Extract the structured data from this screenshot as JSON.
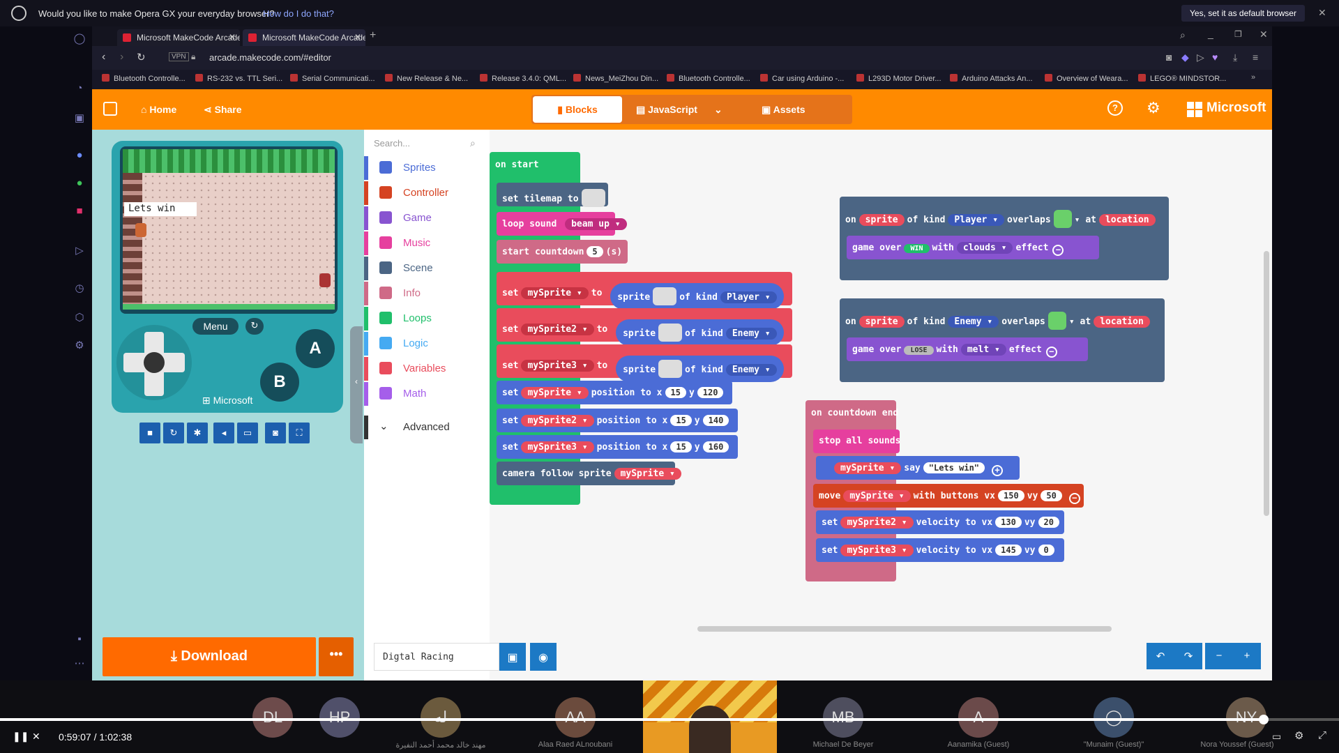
{
  "opera_bar": {
    "message": "Would you like to make Opera GX your everyday browser?",
    "how_link": "How do I do that?",
    "default_button": "Yes, set it as default browser"
  },
  "browser": {
    "tabs": [
      {
        "title": "Microsoft MakeCode Arcade"
      },
      {
        "title": "Microsoft MakeCode Arcade"
      }
    ],
    "url": "arcade.makecode.com/#editor",
    "vpn": "VPN",
    "bookmarks": [
      "Bluetooth Controlle...",
      "RS-232 vs. TTL Seri...",
      "Serial Communicati...",
      "New Release & Ne...",
      "Release 3.4.0: QML...",
      "News_MeiZhou Din...",
      "Bluetooth Controlle...",
      "Car using Arduino -...",
      "L293D Motor Driver...",
      "Arduino Attacks An...",
      "Overview of Weara...",
      "LEGO® MINDSTOR..."
    ]
  },
  "header": {
    "home": "Home",
    "share": "Share",
    "blocks": "Blocks",
    "javascript": "JavaScript",
    "assets": "Assets",
    "help": "?",
    "brand": "Microsoft"
  },
  "simulator": {
    "say_text": "Lets win",
    "menu": "Menu",
    "a": "A",
    "b": "B",
    "brand": "Microsoft",
    "download": "Download",
    "more": "•••"
  },
  "toolbox": {
    "search_placeholder": "Search...",
    "items": [
      {
        "label": "Sprites",
        "color": "#4b6cd6"
      },
      {
        "label": "Controller",
        "color": "#d54322"
      },
      {
        "label": "Game",
        "color": "#8854d0"
      },
      {
        "label": "Music",
        "color": "#e63f9e"
      },
      {
        "label": "Scene",
        "color": "#4b6584"
      },
      {
        "label": "Info",
        "color": "#cf6a87"
      },
      {
        "label": "Loops",
        "color": "#20bf6b"
      },
      {
        "label": "Logic",
        "color": "#45aaf2"
      },
      {
        "label": "Variables",
        "color": "#e94c5c"
      },
      {
        "label": "Math",
        "color": "#a55eea"
      }
    ],
    "advanced": "Advanced"
  },
  "blocks": {
    "on_start": "on start",
    "set_tilemap": "set tilemap to",
    "loop_sound": "loop sound",
    "loop_sound_val": "beam up",
    "start_countdown": "start countdown",
    "countdown_val": "5",
    "countdown_unit": "(s)",
    "set": "set",
    "to": "to",
    "sprite": "sprite",
    "of_kind": "of kind",
    "mySprite": "mySprite",
    "mySprite2": "mySprite2",
    "mySprite3": "mySprite3",
    "player": "Player",
    "enemy": "Enemy",
    "position_to_x": "position to x",
    "y": "y",
    "pos1": [
      "15",
      "120"
    ],
    "pos2": [
      "15",
      "140"
    ],
    "pos3": [
      "15",
      "160"
    ],
    "camera_follow": "camera follow sprite",
    "on": "on",
    "overlaps": "overlaps",
    "at": "at",
    "location": "location",
    "game_over": "game over",
    "win": "WIN",
    "lose": "LOSE",
    "with": "with",
    "clouds": "clouds",
    "melt": "melt",
    "effect": "effect",
    "on_countdown_end": "on countdown end",
    "stop_all_sounds": "stop all sounds",
    "say": "say",
    "lets_win": "\"Lets win\"",
    "move": "move",
    "with_buttons_vx": "with buttons vx",
    "vy": "vy",
    "move_vals": [
      "150",
      "50"
    ],
    "velocity_to_vx": "velocity to vx",
    "vel2": [
      "130",
      "20"
    ],
    "vel3": [
      "145",
      "0"
    ]
  },
  "workspace": {
    "project_name": "Digtal Racing"
  },
  "meeting": {
    "participants": [
      {
        "initials": "DL",
        "name": ""
      },
      {
        "initials": "HP",
        "name": ""
      },
      {
        "initials": "له",
        "name": "مهند خالد محمد أحمد النفيرة"
      },
      {
        "initials": "AA",
        "name": "Alaa Raed ALnoubani"
      },
      {
        "initials": "MB",
        "name": "Michael De Beyer"
      },
      {
        "initials": "A",
        "name": "Aanamika (Guest)"
      },
      {
        "initials": "",
        "name": "\"Munaim (Guest)\""
      },
      {
        "initials": "NY",
        "name": "Nora Youssef (Guest)"
      }
    ],
    "time_current": "0:59:07",
    "time_sep": "/",
    "time_total": "1:02:38",
    "progress": 0.944
  }
}
